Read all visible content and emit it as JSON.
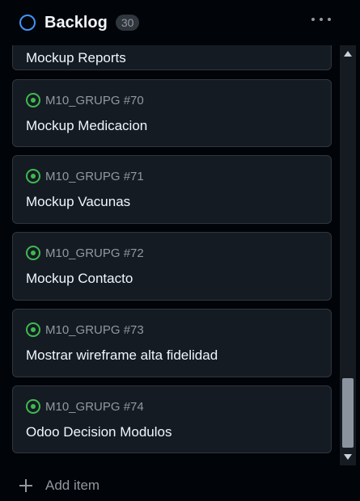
{
  "column": {
    "title": "Backlog",
    "count": "30",
    "status_color": "#4493f8",
    "more_icon": "kebab-horizontal-icon"
  },
  "cards": [
    {
      "ref": "",
      "title": "Mockup Reports"
    },
    {
      "ref": "M10_GRUPG #70",
      "title": "Mockup Medicacion"
    },
    {
      "ref": "M10_GRUPG #71",
      "title": "Mockup Vacunas"
    },
    {
      "ref": "M10_GRUPG #72",
      "title": "Mockup Contacto"
    },
    {
      "ref": "M10_GRUPG #73",
      "title": "Mostrar wireframe alta fidelidad"
    },
    {
      "ref": "M10_GRUPG #74",
      "title": "Odoo Decision Modulos"
    }
  ],
  "issue_icon": {
    "name": "issue-opened-icon",
    "color": "#3fb950"
  },
  "footer": {
    "add_label": "Add item",
    "icon": "plus-icon"
  }
}
